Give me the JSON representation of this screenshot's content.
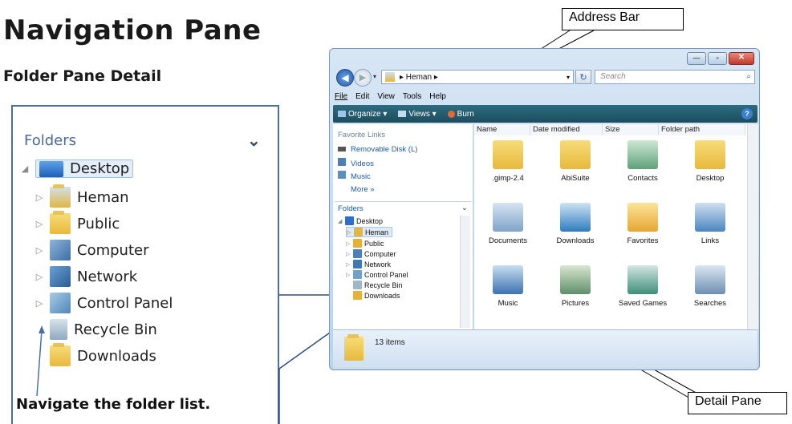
{
  "page": {
    "title": "Navigation Pane",
    "subtitle": "Folder Pane Detail",
    "note": "Navigate the folder list."
  },
  "callouts": {
    "address_bar": "Address Bar",
    "detail_pane": "Detail Pane"
  },
  "detail_folders": {
    "header": "Folders",
    "items": [
      {
        "label": "Desktop",
        "icon": "desktop-icon",
        "color": "#2f6fc7"
      },
      {
        "label": "Heman",
        "icon": "user-folder-icon",
        "color": "#e2b640"
      },
      {
        "label": "Public",
        "icon": "folder-icon",
        "color": "#e6b13a"
      },
      {
        "label": "Computer",
        "icon": "computer-icon",
        "color": "#4d7fb8"
      },
      {
        "label": "Network",
        "icon": "network-icon",
        "color": "#3f78b5"
      },
      {
        "label": "Control Panel",
        "icon": "control-panel-icon",
        "color": "#6fa0c8"
      },
      {
        "label": "Recycle Bin",
        "icon": "recycle-bin-icon",
        "color": "#9fb7c9"
      },
      {
        "label": "Downloads",
        "icon": "downloads-folder-icon",
        "color": "#e6b13a"
      }
    ]
  },
  "explorer": {
    "address_path": "▸ Heman ▸",
    "search_placeholder": "Search",
    "menu": [
      "File",
      "Edit",
      "View",
      "Tools",
      "Help"
    ],
    "toolbar": [
      "Organize ▾",
      "Views ▾",
      "Burn"
    ],
    "favorite_links_header": "Favorite Links",
    "favorite_links": [
      "Removable Disk (L)",
      "Videos",
      "Music",
      "More »"
    ],
    "folders_header": "Folders",
    "tree": [
      "Desktop",
      "Heman",
      "Public",
      "Computer",
      "Network",
      "Control Panel",
      "Recycle Bin",
      "Downloads"
    ],
    "columns": [
      "Name",
      "Date modified",
      "Size",
      "Folder path"
    ],
    "items": [
      {
        "label": ".gimp-2.4",
        "icon": "folder-icon"
      },
      {
        "label": "AbiSuite",
        "icon": "folder-icon"
      },
      {
        "label": "Contacts",
        "icon": "contacts-folder-icon"
      },
      {
        "label": "Desktop",
        "icon": "folder-icon"
      },
      {
        "label": "Documents",
        "icon": "documents-folder-icon"
      },
      {
        "label": "Downloads",
        "icon": "downloads-folder-icon"
      },
      {
        "label": "Favorites",
        "icon": "favorites-folder-icon"
      },
      {
        "label": "Links",
        "icon": "links-folder-icon"
      },
      {
        "label": "Music",
        "icon": "music-folder-icon"
      },
      {
        "label": "Pictures",
        "icon": "pictures-folder-icon"
      },
      {
        "label": "Saved Games",
        "icon": "saved-games-folder-icon"
      },
      {
        "label": "Searches",
        "icon": "searches-folder-icon"
      }
    ],
    "status": "13 items"
  }
}
